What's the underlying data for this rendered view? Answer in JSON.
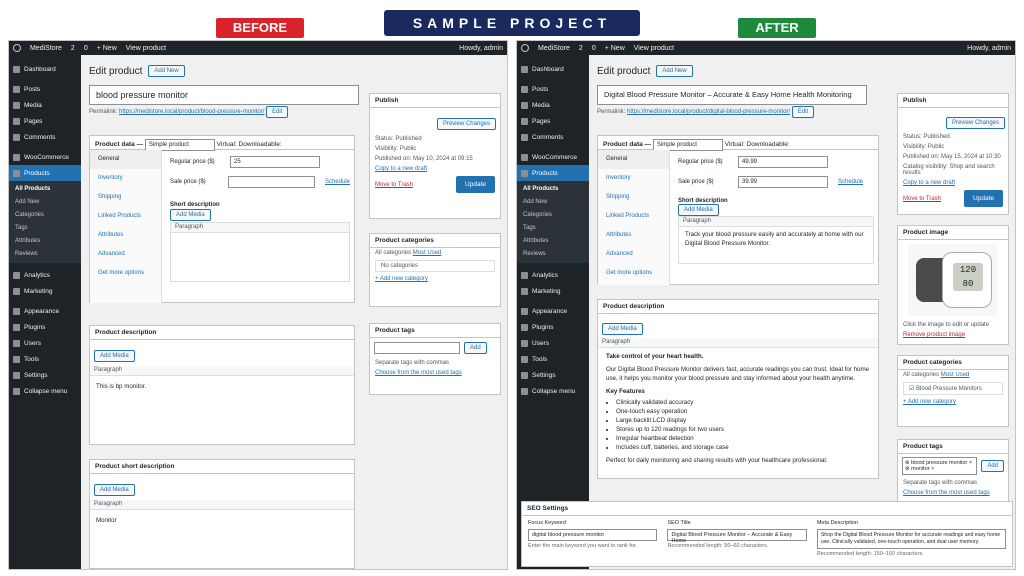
{
  "header": {
    "ribbon": "SAMPLE PROJECT",
    "before": "BEFORE",
    "after": "AFTER"
  },
  "adminbar": {
    "site": "MediStore",
    "updates": "2",
    "comments": "0",
    "new": "+ New",
    "view": "View product",
    "howdy": "Howdy, admin"
  },
  "sidebar": {
    "items": [
      "Dashboard",
      "Posts",
      "Media",
      "Pages",
      "Comments",
      "WooCommerce",
      "Products",
      "Analytics",
      "Marketing",
      "Appearance",
      "Plugins",
      "Users",
      "Tools",
      "Settings",
      "Collapse menu"
    ],
    "sub": [
      "All Products",
      "Add New",
      "Categories",
      "Tags",
      "Attributes",
      "Reviews"
    ]
  },
  "common": {
    "edit_product": "Edit product",
    "add_new": "Add New",
    "permalink": "Permalink:",
    "edit": "Edit",
    "product_data": "Product data —",
    "simple_product": "Simple product",
    "virtual": "Virtual:",
    "downloadable": "Downloadable:",
    "tabs": [
      "General",
      "Inventory",
      "Shipping",
      "Linked Products",
      "Attributes",
      "Advanced",
      "Get more options"
    ],
    "regular_price": "Regular price ($)",
    "sale_price": "Sale price ($)",
    "schedule": "Schedule",
    "short_description": "Short description",
    "add_media": "Add Media",
    "visual": "Visual",
    "text": "Text",
    "paragraph": "Paragraph",
    "product_description": "Product description",
    "publish": "Publish",
    "preview": "Preview Changes",
    "status": "Status: Published",
    "edit_l": "Edit",
    "visibility": "Visibility: Public",
    "copy": "Copy to a new draft",
    "trash": "Move to Trash",
    "update": "Update",
    "product_categories": "Product categories",
    "all_categories": "All categories",
    "most_used": "Most Used",
    "product_tags": "Product tags",
    "add": "Add",
    "separate": "Separate tags with commas",
    "choose": "Choose from the most used tags",
    "add_cat": "+ Add new category"
  },
  "before": {
    "title": "blood pressure monitor",
    "url": "https://medistore.local/product/blood-pressure-monitor/",
    "regular": "25",
    "published": "Published on: May 10, 2024 at 09:15",
    "no_categories": "No categories",
    "desc": "This is bp monitor.",
    "short_box": "Product short description",
    "short": "Monitor"
  },
  "after": {
    "title": "Digital Blood Pressure Monitor – Accurate & Easy Home Health Monitoring",
    "url": "https://medistore.local/product/digital-blood-pressure-monitor/",
    "regular": "49.99",
    "sale": "39.99",
    "short": "Track your blood pressure easily and accurately at home with our Digital Blood Pressure Monitor.",
    "desc_h": "Take control of your heart health.",
    "desc_p": "Our Digital Blood Pressure Monitor delivers fast, accurate readings you can trust. Ideal for home use, it helps you monitor your blood pressure and stay informed about your health anytime.",
    "features_h": "Key Features",
    "features": [
      "Clinically validated accuracy",
      "One-touch easy operation",
      "Large backlit LCD display",
      "Stores up to 120 readings for two users",
      "Irregular heartbeat detection",
      "Includes cuff, batteries, and storage case"
    ],
    "desc_end": "Perfect for daily monitoring and sharing results with your healthcare professional.",
    "published": "Published on: May 15, 2024 at 10:30",
    "catalog": "Catalog visibility: Shop and search results",
    "image_box": "Product image",
    "image_hint": "Click the image to edit or update",
    "remove_image": "Remove product image",
    "category": "Blood Pressure Monitors",
    "tags": [
      "blood pressure monitor",
      "monitor"
    ],
    "seo": {
      "title": "SEO Settings",
      "kw_label": "Focus Keyword",
      "kw": "digital blood pressure monitor",
      "kw_hint": "Enter the main keyword you want to rank for.",
      "t_label": "SEO Title",
      "t": "Digital Blood Pressure Monitor – Accurate & Easy Home",
      "t_hint": "Recommended length: 50–60 characters.",
      "m_label": "Meta Description",
      "m": "Shop the Digital Blood Pressure Monitor for accurate readings and easy home use. Clinically validated, one-touch operation, and dual user memory.",
      "m_hint": "Recommended length: 150–160 characters."
    },
    "screen": [
      "120",
      "80"
    ]
  }
}
